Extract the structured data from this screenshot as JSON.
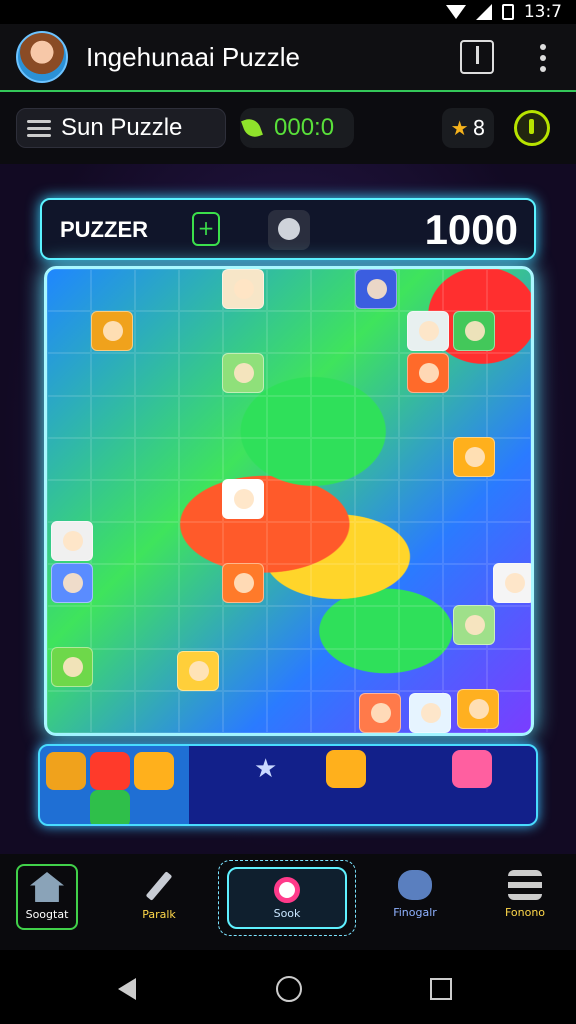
{
  "status_bar": {
    "time": "13:7"
  },
  "app_bar": {
    "title": "Ingehunaai Puzzle"
  },
  "toolbar": {
    "mode_label": "Sun Puzzle",
    "timer": "000:0",
    "stars": "8"
  },
  "score_panel": {
    "label": "PUZZER",
    "badge": "+",
    "score": "1000"
  },
  "tray": {
    "star_glyph": "★"
  },
  "bottom_nav": {
    "home": "Soogtat",
    "pencil": "Paralk",
    "center": "Sook",
    "gallery": "Finogalr",
    "menu": "Fonono"
  },
  "colors": {
    "accent_green": "#34c759",
    "glow_cyan": "#5bf2ff",
    "timer_green": "#59e03a",
    "star_gold": "#f5b21c",
    "hint_yellow": "#b8e400"
  }
}
